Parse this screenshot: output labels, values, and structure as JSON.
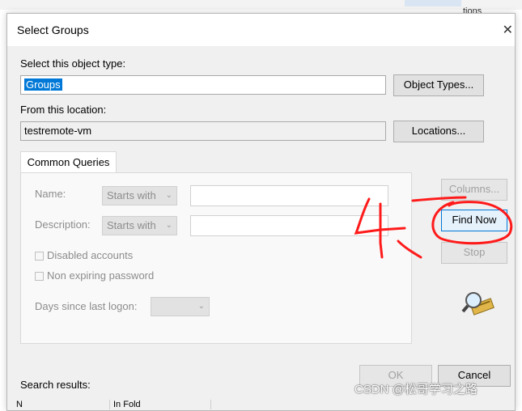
{
  "background": {
    "partial_text": "tions"
  },
  "dialog": {
    "title": "Select Groups",
    "object_type": {
      "label": "Select this object type:",
      "value": "Groups",
      "button": "Object Types..."
    },
    "location": {
      "label": "From this location:",
      "value": "testremote-vm",
      "button": "Locations..."
    },
    "tab": "Common Queries",
    "queries": {
      "name_label": "Name:",
      "name_mode": "Starts with",
      "description_label": "Description:",
      "description_mode": "Starts with",
      "disabled_accounts": "Disabled accounts",
      "non_expiring_password": "Non expiring password",
      "days_since_logon": "Days since last logon:"
    },
    "side_buttons": {
      "columns": "Columns...",
      "find_now": "Find Now",
      "stop": "Stop"
    },
    "footer": {
      "ok": "OK",
      "cancel": "Cancel",
      "search_results": "Search results:"
    },
    "result_columns": [
      "N",
      "In Fold"
    ]
  },
  "annotation": {
    "text": "4"
  },
  "watermark": "CSDN @松哥学习之路",
  "colors": {
    "selection": "#0078d7",
    "annotation_red": "#ff1a1a"
  }
}
